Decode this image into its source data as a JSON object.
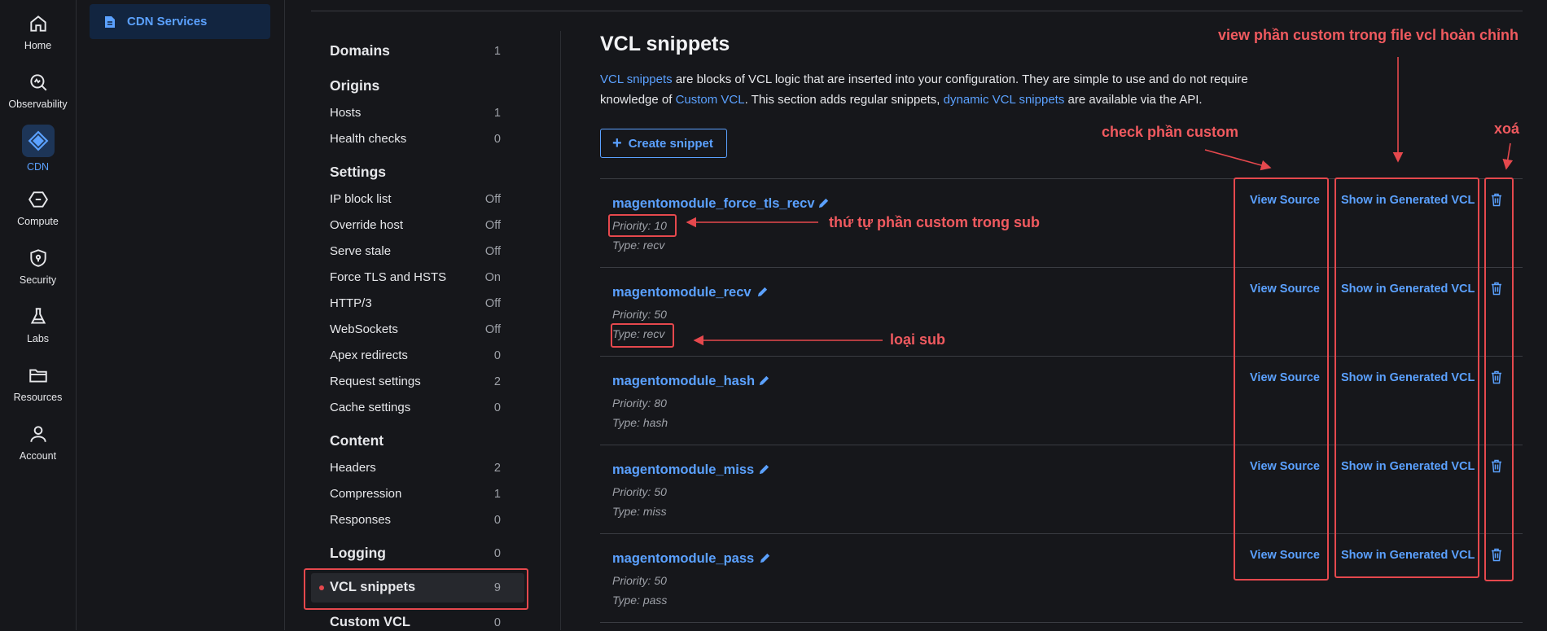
{
  "rail": {
    "items": [
      {
        "label": "Home",
        "icon": "home-icon"
      },
      {
        "label": "Observability",
        "icon": "observability-icon"
      },
      {
        "label": "CDN",
        "icon": "cdn-icon",
        "active": true
      },
      {
        "label": "Compute",
        "icon": "compute-icon"
      },
      {
        "label": "Security",
        "icon": "shield-icon"
      },
      {
        "label": "Labs",
        "icon": "flask-icon"
      },
      {
        "label": "Resources",
        "icon": "folder-icon"
      },
      {
        "label": "Account",
        "icon": "user-icon"
      }
    ]
  },
  "subnav": {
    "label": "CDN Services",
    "icon": "document-icon"
  },
  "settings_nav": {
    "domains": {
      "label": "Domains",
      "count": "1"
    },
    "origins": {
      "label": "Origins"
    },
    "hosts": {
      "label": "Hosts",
      "count": "1"
    },
    "health_checks": {
      "label": "Health checks",
      "count": "0"
    },
    "settings": {
      "label": "Settings"
    },
    "ip_block_list": {
      "label": "IP block list",
      "value": "Off"
    },
    "override_host": {
      "label": "Override host",
      "value": "Off"
    },
    "serve_stale": {
      "label": "Serve stale",
      "value": "Off"
    },
    "force_tls": {
      "label": "Force TLS and HSTS",
      "value": "On"
    },
    "http3": {
      "label": "HTTP/3",
      "value": "Off"
    },
    "websockets": {
      "label": "WebSockets",
      "value": "Off"
    },
    "apex_redirects": {
      "label": "Apex redirects",
      "count": "0"
    },
    "request_settings": {
      "label": "Request settings",
      "count": "2"
    },
    "cache_settings": {
      "label": "Cache settings",
      "count": "0"
    },
    "content": {
      "label": "Content"
    },
    "headers": {
      "label": "Headers",
      "count": "2"
    },
    "compression": {
      "label": "Compression",
      "count": "1"
    },
    "responses": {
      "label": "Responses",
      "count": "0"
    },
    "logging": {
      "label": "Logging",
      "count": "0"
    },
    "vcl_snippets": {
      "label": "VCL snippets",
      "count": "9"
    },
    "custom_vcl": {
      "label": "Custom VCL",
      "count": "0"
    }
  },
  "main": {
    "title": "VCL snippets",
    "desc": {
      "link1": "VCL snippets",
      "t1": " are blocks of VCL logic that are inserted into your configuration. They are simple to use and do not require knowledge of ",
      "link2": "Custom VCL",
      "t2": ". This section adds regular snippets, ",
      "link3": "dynamic VCL snippets",
      "t3": " are available via the API."
    },
    "create_label": "Create snippet",
    "view_source": "View Source",
    "show_generated": "Show in Generated VCL",
    "snippets": [
      {
        "name": "magentomodule_force_tls_recv",
        "priority": "Priority: 10",
        "type": "Type: recv"
      },
      {
        "name": "magentomodule_recv",
        "priority": "Priority: 50",
        "type": "Type: recv"
      },
      {
        "name": "magentomodule_hash",
        "priority": "Priority: 80",
        "type": "Type: hash"
      },
      {
        "name": "magentomodule_miss",
        "priority": "Priority: 50",
        "type": "Type: miss"
      },
      {
        "name": "magentomodule_pass",
        "priority": "Priority: 50",
        "type": "Type: pass"
      }
    ]
  },
  "annotations": {
    "view_generated": "view phần custom trong file vcl hoàn chỉnh",
    "check_custom": "check phần custom",
    "delete": "xoá",
    "order": "thứ tự phần custom trong sub",
    "type": "loại sub"
  },
  "colors": {
    "accent": "#5ba1ff",
    "annotation": "#e5484d",
    "background": "#16171b"
  }
}
